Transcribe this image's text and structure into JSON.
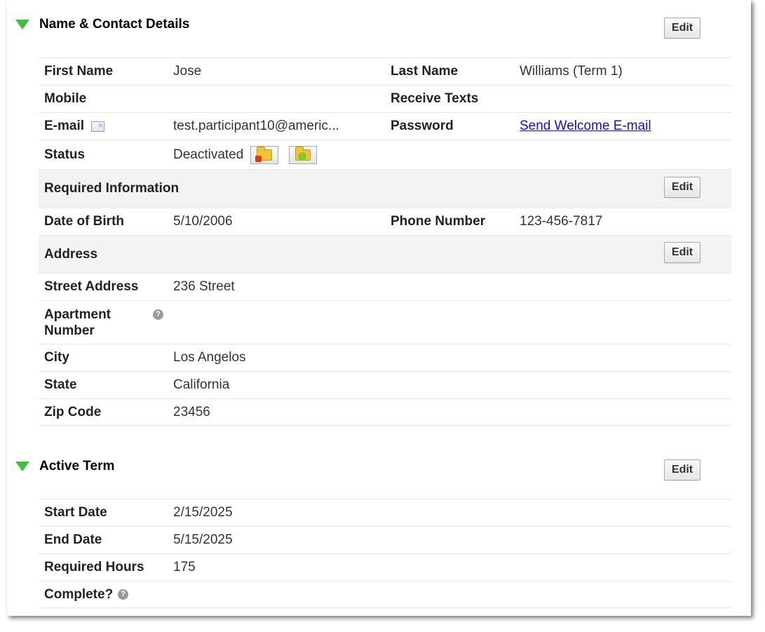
{
  "sections": {
    "contact": {
      "title": "Name & Contact Details",
      "edit_label": "Edit",
      "first_name_label": "First Name",
      "first_name_value": "Jose",
      "last_name_label": "Last Name",
      "last_name_value": "Williams (Term 1)",
      "mobile_label": "Mobile",
      "receive_texts_label": "Receive Texts",
      "email_label": "E-mail",
      "email_value": "test.participant10@americ...",
      "password_label": "Password",
      "password_link": "Send Welcome E-mail",
      "status_label": "Status",
      "status_value": "Deactivated"
    },
    "required": {
      "title": "Required Information",
      "edit_label": "Edit",
      "dob_label": "Date of Birth",
      "dob_value": "5/10/2006",
      "phone_label": "Phone Number",
      "phone_value": "123-456-7817"
    },
    "address": {
      "title": "Address",
      "edit_label": "Edit",
      "street_label": "Street Address",
      "street_value": "236 Street",
      "apt_label_1": "Apartment",
      "apt_label_2": "Number",
      "city_label": "City",
      "city_value": "Los Angelos",
      "state_label": "State",
      "state_value": "California",
      "zip_label": "Zip Code",
      "zip_value": "23456"
    },
    "term": {
      "title": "Active Term",
      "edit_label": "Edit",
      "start_label": "Start Date",
      "start_value": "2/15/2025",
      "end_label": "End Date",
      "end_value": "5/15/2025",
      "hours_label": "Required Hours",
      "hours_value": "175",
      "complete_label": "Complete?"
    }
  },
  "help_glyph": "?",
  "icons": [
    "expand-triangle-icon",
    "email-card-icon",
    "folder-deactivate-icon",
    "folder-activate-icon",
    "help-icon"
  ],
  "colors": {
    "accent_green": "#3fbf3a",
    "link": "#1a0dcc",
    "subheader_bg": "#f3f3f3"
  }
}
